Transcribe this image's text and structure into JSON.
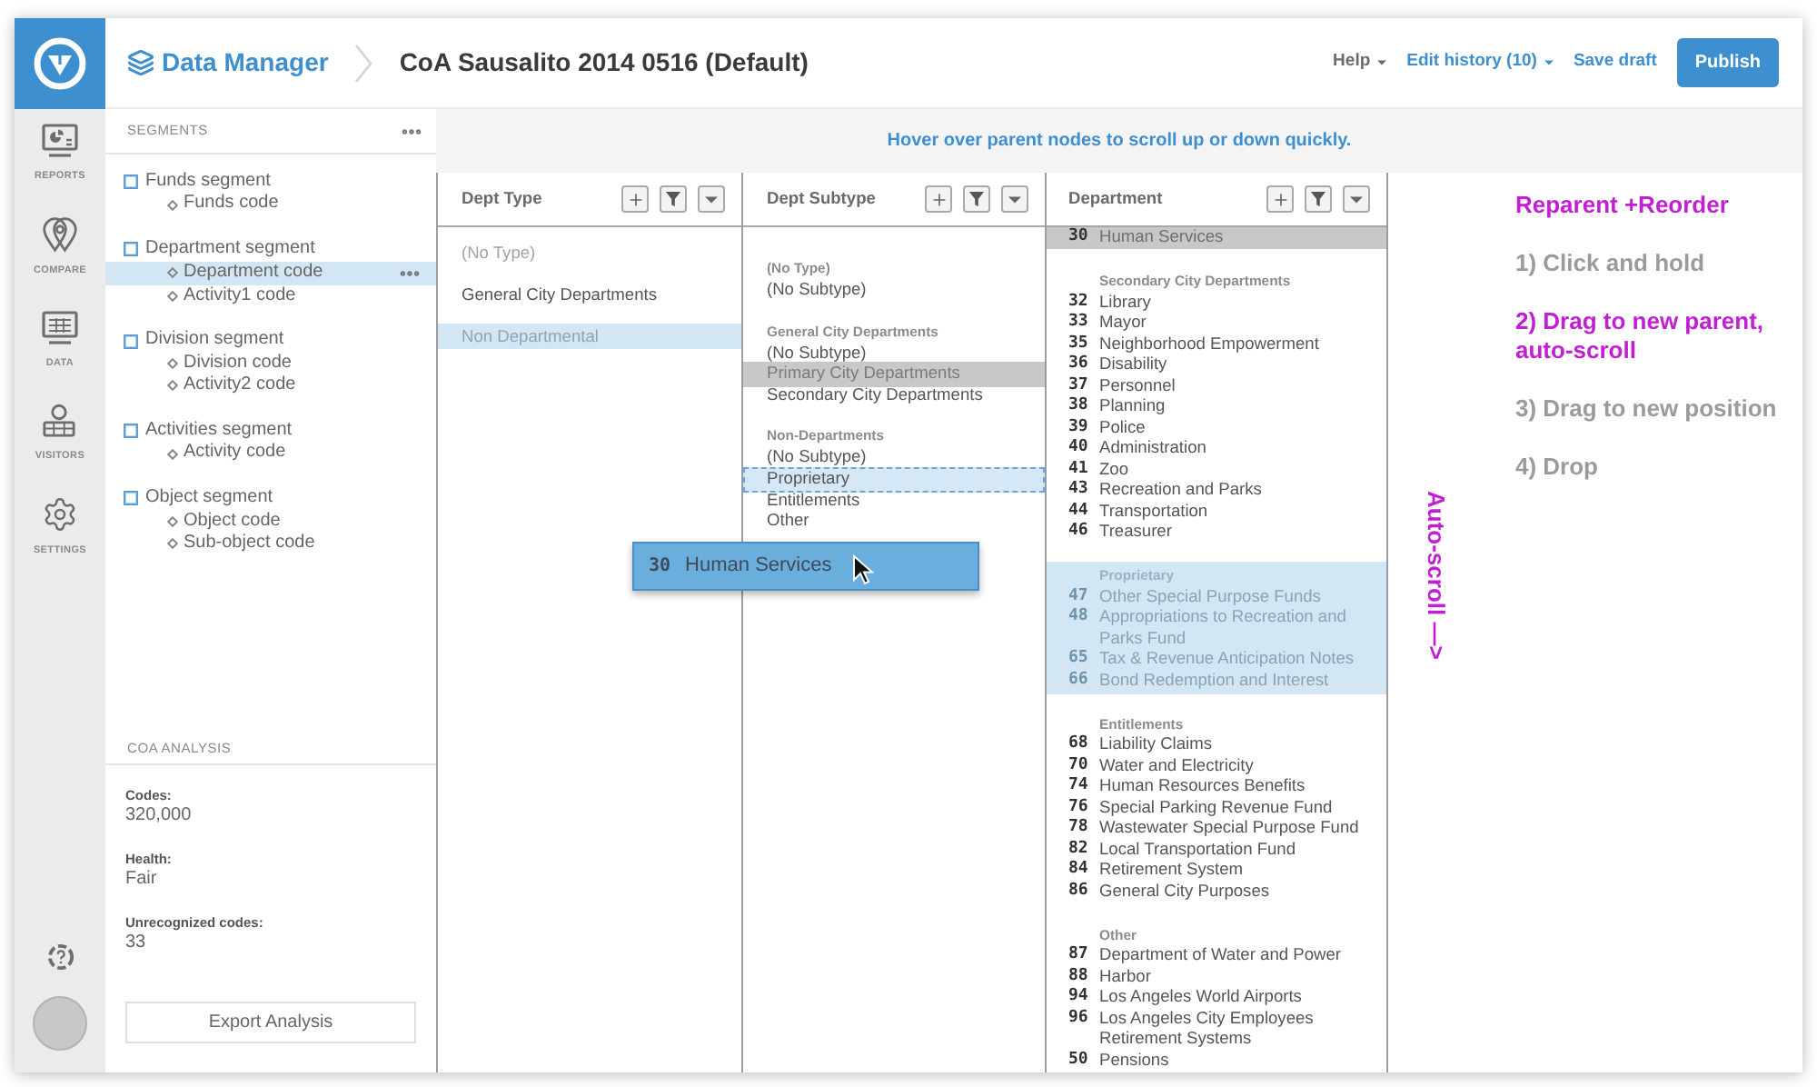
{
  "header": {
    "section": "Data Manager",
    "title": "CoA Sausalito 2014 0516 (Default)",
    "actions": [
      {
        "label": "Help",
        "kind": "menu",
        "caret": true
      },
      {
        "label": "Edit history (10)",
        "kind": "link",
        "caret": true
      },
      {
        "label": "Save draft",
        "kind": "link",
        "caret": false
      },
      {
        "label": "Publish",
        "kind": "primary",
        "caret": false
      }
    ]
  },
  "nav": [
    "REPORTS",
    "COMPARE",
    "DATA",
    "VISITORS",
    "SETTINGS"
  ],
  "segments": {
    "title": "SEGMENTS",
    "items": [
      {
        "label": "Funds segment",
        "children": [
          {
            "label": "Funds code",
            "selected": false
          }
        ]
      },
      {
        "label": "Department segment",
        "children": [
          {
            "label": "Department code",
            "selected": true
          },
          {
            "label": "Activity1 code",
            "selected": false
          }
        ]
      },
      {
        "label": "Division segment",
        "children": [
          {
            "label": "Division code",
            "selected": false
          },
          {
            "label": "Activity2 code",
            "selected": false
          }
        ]
      },
      {
        "label": "Activities segment",
        "children": [
          {
            "label": "Activity code",
            "selected": false
          }
        ]
      },
      {
        "label": "Object segment",
        "children": [
          {
            "label": "Object code",
            "selected": false
          },
          {
            "label": "Sub-object code",
            "selected": false
          }
        ]
      }
    ]
  },
  "analysis": {
    "title": "COA ANALYSIS",
    "stats": [
      {
        "label": "Codes:",
        "value": "320,000"
      },
      {
        "label": "Health:",
        "value": "Fair"
      },
      {
        "label": "Unrecognized codes:",
        "value": "33"
      }
    ],
    "button": "Export Analysis"
  },
  "notice": "Hover over parent nodes to scroll up or down quickly.",
  "columns": [
    {
      "title": "Dept Type",
      "items": [
        {
          "label": "(No Type)",
          "dimmed": true,
          "highlighted": false
        },
        {
          "label": "General City Departments",
          "dimmed": false,
          "highlighted": false
        },
        {
          "label": "Non Departmental",
          "dimmed": false,
          "highlighted": true
        }
      ]
    },
    {
      "title": "Dept Subtype",
      "groups": [
        {
          "title": "(No Type)",
          "items": [
            {
              "label": "(No Subtype)",
              "selected": false,
              "drop_target": false
            }
          ]
        },
        {
          "title": "General City Departments",
          "items": [
            {
              "label": "(No Subtype)",
              "selected": false,
              "drop_target": false
            },
            {
              "label": "Primary City Departments",
              "selected": true,
              "drop_target": false
            },
            {
              "label": "Secondary City Departments",
              "selected": false,
              "drop_target": false
            }
          ]
        },
        {
          "title": "Non-Departments",
          "items": [
            {
              "label": "(No Subtype)",
              "selected": false,
              "drop_target": false
            },
            {
              "label": "Proprietary",
              "selected": false,
              "drop_target": true
            },
            {
              "label": "Entitlements",
              "selected": false,
              "drop_target": false
            },
            {
              "label": "Other",
              "selected": false,
              "drop_target": false
            }
          ]
        }
      ]
    },
    {
      "title": "Department",
      "groups": [
        {
          "highlighted": false,
          "items": [
            {
              "code": "30",
              "label": "Human Services",
              "selected": true
            }
          ]
        },
        {
          "title": "Secondary City Departments",
          "highlighted": false,
          "items": [
            {
              "code": "32",
              "label": "Library",
              "selected": false
            },
            {
              "code": "33",
              "label": "Mayor",
              "selected": false
            },
            {
              "code": "35",
              "label": "Neighborhood Empowerment",
              "selected": false
            },
            {
              "code": "36",
              "label": "Disability",
              "selected": false
            },
            {
              "code": "37",
              "label": "Personnel",
              "selected": false
            },
            {
              "code": "38",
              "label": "Planning",
              "selected": false
            },
            {
              "code": "39",
              "label": "Police",
              "selected": false
            },
            {
              "code": "40",
              "label": "Administration",
              "selected": false
            },
            {
              "code": "41",
              "label": "Zoo",
              "selected": false
            },
            {
              "code": "43",
              "label": "Recreation and Parks",
              "selected": false
            },
            {
              "code": "44",
              "label": "Transportation",
              "selected": false
            },
            {
              "code": "46",
              "label": "Treasurer",
              "selected": false
            }
          ]
        },
        {
          "title": "Proprietary",
          "highlighted": true,
          "items": [
            {
              "code": "47",
              "label": "Other Special Purpose Funds",
              "selected": false
            },
            {
              "code": "48",
              "label": "Appropriations to Recreation and Parks Fund",
              "selected": false
            },
            {
              "code": "65",
              "label": "Tax & Revenue Anticipation Notes",
              "selected": false
            },
            {
              "code": "66",
              "label": "Bond Redemption and Interest",
              "selected": false
            }
          ]
        },
        {
          "title": "Entitlements",
          "highlighted": false,
          "items": [
            {
              "code": "68",
              "label": "Liability Claims",
              "selected": false
            },
            {
              "code": "70",
              "label": "Water and Electricity",
              "selected": false
            },
            {
              "code": "74",
              "label": "Human Resources Benefits",
              "selected": false
            },
            {
              "code": "76",
              "label": "Special Parking Revenue Fund",
              "selected": false
            },
            {
              "code": "78",
              "label": "Wastewater Special Purpose Fund",
              "selected": false
            },
            {
              "code": "82",
              "label": "Local Transportation Fund",
              "selected": false
            },
            {
              "code": "84",
              "label": "Retirement System",
              "selected": false
            },
            {
              "code": "86",
              "label": "General City Purposes",
              "selected": false
            }
          ]
        },
        {
          "title": "Other",
          "highlighted": false,
          "items": [
            {
              "code": "87",
              "label": "Department of Water and Power",
              "selected": false
            },
            {
              "code": "88",
              "label": "Harbor",
              "selected": false
            },
            {
              "code": "94",
              "label": "Los Angeles World Airports",
              "selected": false
            },
            {
              "code": "96",
              "label": "Los Angeles City Employees Retirement Systems",
              "selected": false
            },
            {
              "code": "50",
              "label": "Pensions",
              "selected": false
            }
          ]
        }
      ]
    }
  ],
  "drag_ghost": {
    "code": "30",
    "label": "Human Services"
  },
  "instructions": {
    "title": "Reparent +Reorder",
    "steps": [
      {
        "text": "1) Click and hold",
        "current": false
      },
      {
        "text": "2) Drag to new parent, auto-scroll",
        "current": true
      },
      {
        "text": "3) Drag to new position",
        "current": false
      },
      {
        "text": "4) Drop",
        "current": false
      }
    ],
    "side_note": "Auto-scroll —>"
  }
}
